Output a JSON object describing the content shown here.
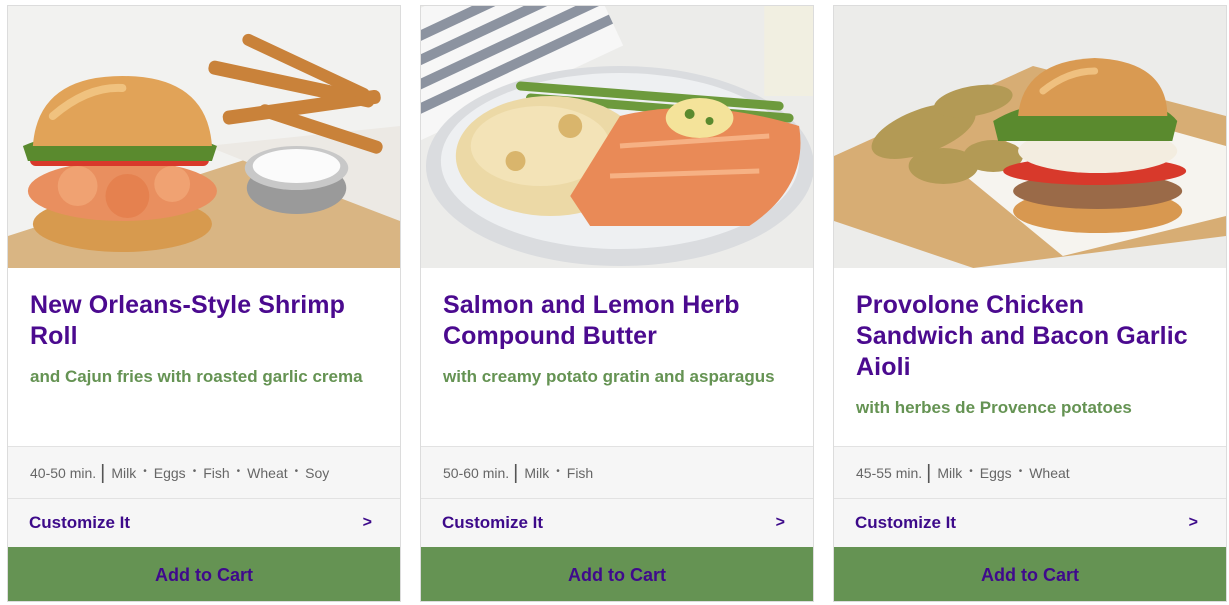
{
  "cards": [
    {
      "title": "New Orleans-Style Shrimp Roll",
      "subtitle": "and Cajun fries with roasted garlic crema",
      "time": "40-50 min.",
      "allergens": [
        "Milk",
        "Eggs",
        "Fish",
        "Wheat",
        "Soy"
      ],
      "customize_label": "Customize It",
      "chevron": ">",
      "add_label": "Add to Cart",
      "photo_icon": "shrimp-roll-photo"
    },
    {
      "title": "Salmon and Lemon Herb Compound Butter",
      "subtitle": "with creamy potato gratin and asparagus",
      "time": "50-60 min.",
      "allergens": [
        "Milk",
        "Fish"
      ],
      "customize_label": "Customize It",
      "chevron": ">",
      "add_label": "Add to Cart",
      "photo_icon": "salmon-plate-photo"
    },
    {
      "title": "Provolone Chicken Sandwich and Bacon Garlic Aioli",
      "subtitle": "with herbes de Provence potatoes",
      "time": "45-55 min.",
      "allergens": [
        "Milk",
        "Eggs",
        "Wheat"
      ],
      "customize_label": "Customize It",
      "chevron": ">",
      "add_label": "Add to Cart",
      "photo_icon": "chicken-sandwich-photo"
    }
  ],
  "colors": {
    "title": "#4b0a8f",
    "subtitle": "#659353",
    "button_bg": "#659353",
    "button_text": "#3f0a8c"
  }
}
